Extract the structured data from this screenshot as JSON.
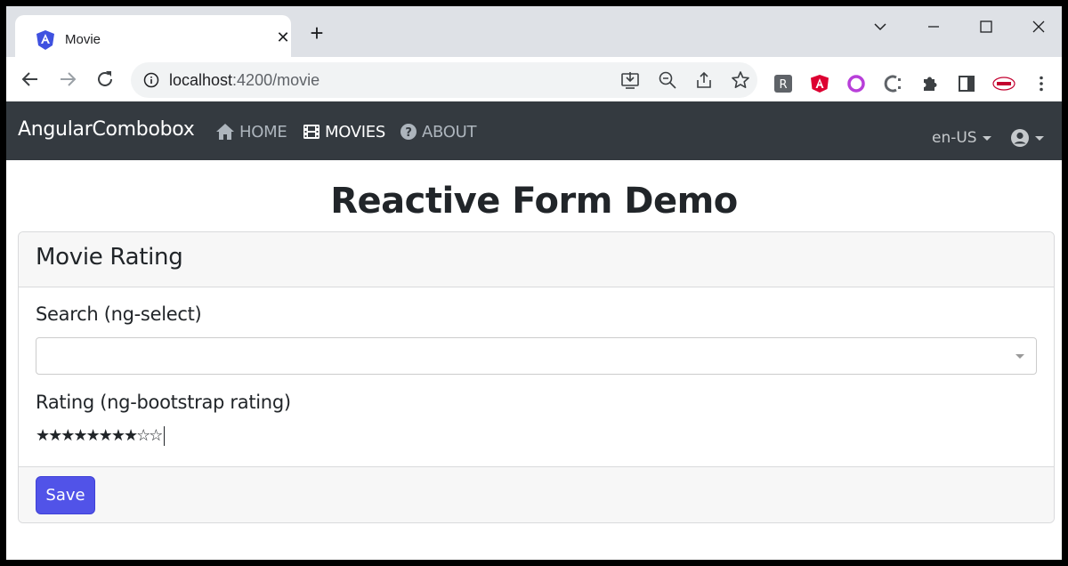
{
  "browser": {
    "tab": {
      "title": "Movie",
      "close_glyph": "✕",
      "favicon": "angular-shield-icon"
    },
    "new_tab_glyph": "+",
    "url": {
      "host": "localhost",
      "path": ":4200/movie"
    },
    "extensions": [
      {
        "name": "R",
        "color": "#5f6368"
      },
      {
        "name": "angular-extension-icon",
        "color": "#dd0031"
      },
      {
        "name": "redux-extension-icon",
        "color": "#b83fd9"
      },
      {
        "name": "c-extension-icon",
        "color": "#5f6368"
      }
    ]
  },
  "navbar": {
    "brand": "AngularCombobox",
    "links": [
      {
        "label": "HOME",
        "icon": "home-icon",
        "active": false
      },
      {
        "label": "MOVIES",
        "icon": "film-icon",
        "active": true
      },
      {
        "label": "ABOUT",
        "icon": "question-icon",
        "active": false
      }
    ],
    "language": "en-US"
  },
  "page": {
    "title": "Reactive Form Demo",
    "card": {
      "title": "Movie Rating",
      "search_label": "Search (ng-select)",
      "search_value": "",
      "rating_label": "Rating (ng-bootstrap rating)",
      "rating_stars": "★★★★★★★★☆☆",
      "rating": {
        "value": 8,
        "max": 10
      },
      "save_label": "Save"
    }
  },
  "colors": {
    "navbar": "#343a40",
    "primary_button": "#5153e8",
    "tab_strip": "#dee1e6"
  }
}
